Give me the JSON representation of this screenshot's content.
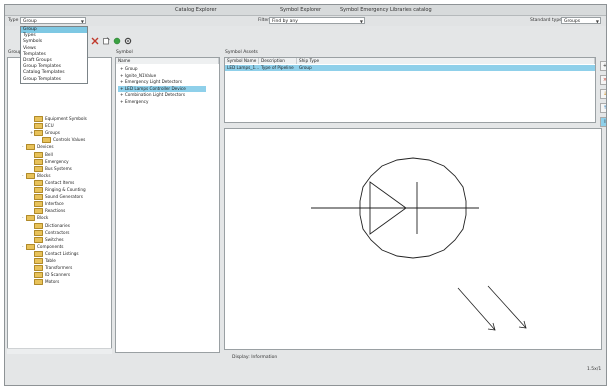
{
  "window": {
    "title_left": "Catalog Explorer",
    "title_center": "Symbol Explorer",
    "title_right": "Symbol Emergency Libraries catalog"
  },
  "filterbar": {
    "type_label": "Type",
    "type_value": "Group",
    "filter_label": "Filter",
    "filter_value": "Find by any",
    "standard_label": "Standard type",
    "standard_value": "Groups"
  },
  "type_dropdown": {
    "options": [
      "Group",
      "Types",
      "Symbols",
      "Views",
      "Templates",
      "Draft Groups",
      "Group Templates",
      "Catalog Templates",
      "Group Templates"
    ],
    "selected_index": 0
  },
  "toolbar": {
    "icons": [
      "delete-icon",
      "new-icon",
      "refresh-icon",
      "settings-icon"
    ]
  },
  "left_panel": {
    "header": "Group",
    "tree": [
      {
        "label": "Equipment Symbols",
        "indent": 3,
        "expander": ""
      },
      {
        "label": "ECU",
        "indent": 3,
        "expander": ""
      },
      {
        "label": "Groups",
        "indent": 3,
        "expander": "+"
      },
      {
        "label": "Controls Values",
        "indent": 4,
        "expander": ""
      },
      {
        "label": "Devices",
        "indent": 2,
        "expander": "-"
      },
      {
        "label": "Bell",
        "indent": 3,
        "expander": ""
      },
      {
        "label": "Emergency",
        "indent": 3,
        "expander": ""
      },
      {
        "label": "Bus Systems",
        "indent": 3,
        "expander": ""
      },
      {
        "label": "Blocks",
        "indent": 2,
        "expander": "-"
      },
      {
        "label": "Contact Items",
        "indent": 3,
        "expander": ""
      },
      {
        "label": "Ringing & Counting",
        "indent": 3,
        "expander": ""
      },
      {
        "label": "Sound Generators",
        "indent": 3,
        "expander": ""
      },
      {
        "label": "Interface",
        "indent": 3,
        "expander": ""
      },
      {
        "label": "Reactions",
        "indent": 3,
        "expander": ""
      },
      {
        "label": "Block",
        "indent": 2,
        "expander": "-"
      },
      {
        "label": "Dictionaries",
        "indent": 3,
        "expander": ""
      },
      {
        "label": "Contractors",
        "indent": 3,
        "expander": ""
      },
      {
        "label": "Switches",
        "indent": 3,
        "expander": ""
      },
      {
        "label": "Components",
        "indent": 2,
        "expander": "-"
      },
      {
        "label": "Contact Listings",
        "indent": 3,
        "expander": ""
      },
      {
        "label": "Table",
        "indent": 3,
        "expander": ""
      },
      {
        "label": "Transformers",
        "indent": 3,
        "expander": ""
      },
      {
        "label": "ID Scanners",
        "indent": 3,
        "expander": ""
      },
      {
        "label": "Motors",
        "indent": 3,
        "expander": ""
      }
    ]
  },
  "middle_panel": {
    "header": "Symbol",
    "column": "Name",
    "items": [
      "Group",
      "Ignite_N1Value",
      "Emergency Light Detectors",
      "LED Lamps Controller Device",
      "Combination Light Detectors",
      "Emergency"
    ],
    "selected_index": 3
  },
  "right_panel": {
    "header": "Symbol Assets",
    "columns": [
      "Symbol Name",
      "Description",
      "Ship Type"
    ],
    "rows": [
      [
        "LED Lamps_1...",
        "Type of Pipeline",
        "Group"
      ]
    ]
  },
  "preview": {
    "status_label": "Display: Information",
    "zoom_label": "1.5x/1"
  },
  "side_buttons": [
    "add-icon",
    "delete-icon",
    "import-icon",
    "export-icon",
    "info-icon"
  ],
  "colors": {
    "accent_selection": "#8fd0ea",
    "dropdown_selection": "#7ec8e3",
    "folder": "#e8c25a"
  }
}
